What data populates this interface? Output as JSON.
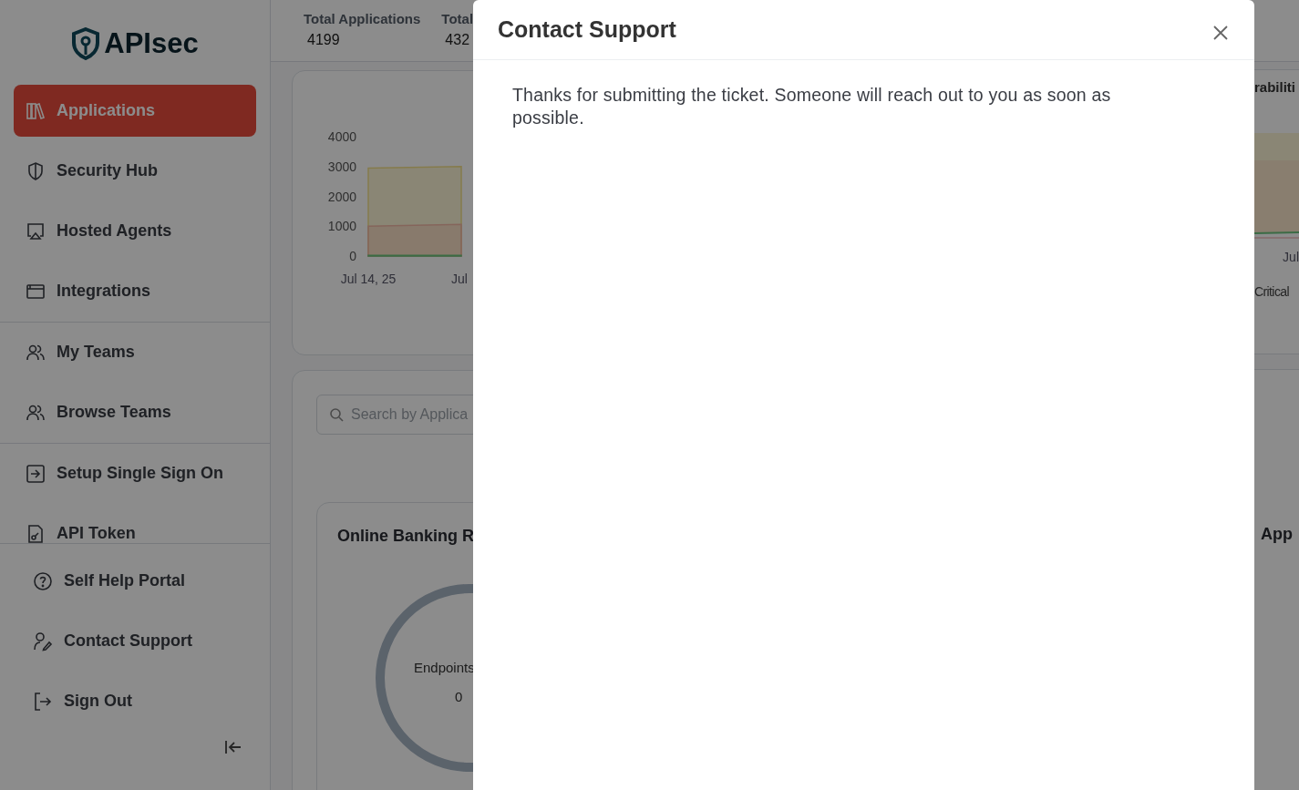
{
  "sidebar": {
    "logo": "APIsec",
    "groups": [
      [
        {
          "label": "Applications",
          "selected": true
        },
        {
          "label": "Security Hub",
          "selected": false
        },
        {
          "label": "Hosted Agents",
          "selected": false
        },
        {
          "label": "Integrations",
          "selected": false
        }
      ],
      [
        {
          "label": "My Teams",
          "selected": false
        },
        {
          "label": "Browse Teams",
          "selected": false
        }
      ],
      [
        {
          "label": "Setup Single Sign On",
          "selected": false
        },
        {
          "label": "API Token",
          "selected": false
        }
      ]
    ],
    "bottom_items": [
      {
        "label": "Self Help Portal"
      },
      {
        "label": "Contact Support"
      },
      {
        "label": "Sign Out"
      }
    ]
  },
  "header": {
    "stats": [
      {
        "label": "Total Applications",
        "value": "4199"
      },
      {
        "label": "Total",
        "value": "432"
      }
    ]
  },
  "trend_card": {
    "chart_data": {
      "type": "area",
      "categories": [
        "Jul 14, 25",
        "Jul"
      ],
      "yticks": [
        0,
        1000,
        2000,
        3000,
        4000
      ],
      "ylim": [
        0,
        4000
      ],
      "series": [
        {
          "color": "#f3e08a",
          "values": [
            2950,
            3000
          ]
        },
        {
          "color": "#f2b8a6",
          "values": [
            1000,
            1060
          ]
        },
        {
          "color": "#6cc47f",
          "values": [
            20,
            20
          ]
        }
      ]
    }
  },
  "apps_panel": {
    "search": {
      "placeholder": "Search by Applica"
    },
    "cards": [
      {
        "title": "Online Banking R",
        "donut_label": "Endpoints",
        "donut_value": "0"
      }
    ]
  },
  "right_fragment": {
    "title": "rabiliti",
    "x_label": "Jul",
    "legend": "Critical",
    "card_title": "App"
  },
  "modal": {
    "title": "Contact Support",
    "message": "Thanks for submitting the ticket. Someone will reach out to you as soon as possible."
  }
}
